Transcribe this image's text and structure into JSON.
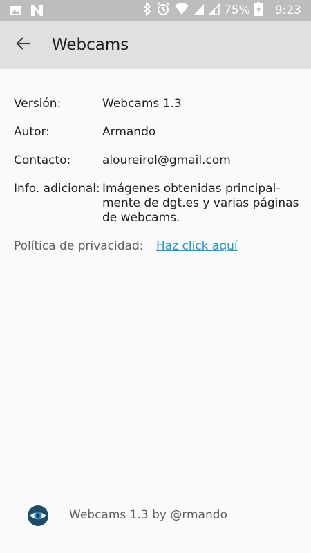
{
  "status_bar": {
    "battery_percent": "75%",
    "time": "9:23",
    "icons": [
      "image-icon",
      "n-app-icon",
      "bluetooth-icon",
      "alarm-icon",
      "wifi-icon",
      "cell-signal-icon",
      "cell-signal-icon",
      "battery-charging-icon"
    ]
  },
  "toolbar": {
    "title": "Webcams",
    "back_icon": "arrow-back-icon"
  },
  "info": {
    "version_label": "Versión:",
    "version_value": "Webcams 1.3",
    "author_label": "Autor:",
    "author_value": "Armando",
    "contact_label": "Contacto:",
    "contact_value": "aloureirol@gmail.com",
    "extra_label": "Info. adicional:",
    "extra_value_line1": "Imágenes obtenidas principal-",
    "extra_value_line2": "mente de dgt.es y varias páginas",
    "extra_value_line3": "de webcams."
  },
  "privacy": {
    "label": "Política de privacidad:",
    "link_text": "Haz click aquí"
  },
  "footer": {
    "logo_icon": "eye-logo-icon",
    "text": "Webcams 1.3 by @rmando"
  },
  "colors": {
    "status_bar": "#bdbdbd",
    "toolbar": "#e0e0e0",
    "background": "#fafafa",
    "link": "#2196c9"
  }
}
